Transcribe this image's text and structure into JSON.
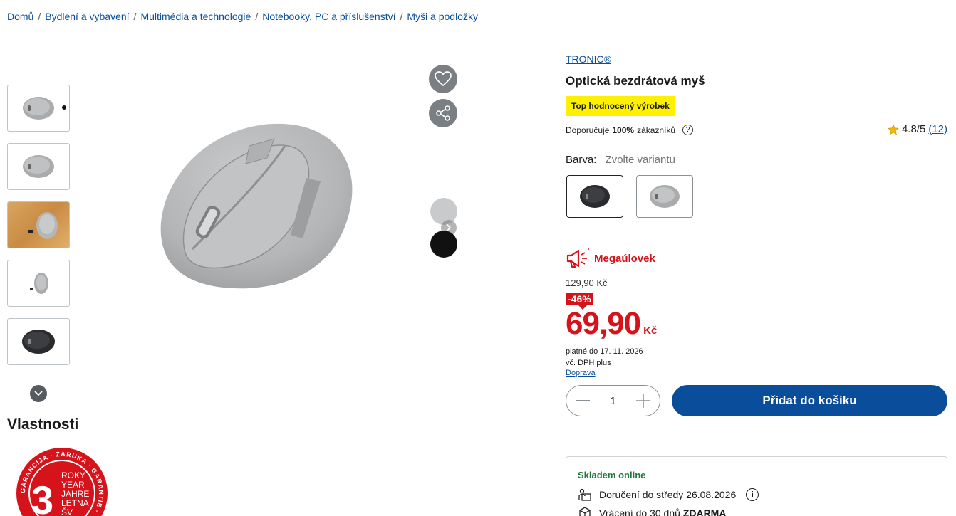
{
  "breadcrumb": [
    "Domů",
    "Bydlení a vybavení",
    "Multimédia a technologie",
    "Notebooky, PC a příslušenství",
    "Myši a podložky"
  ],
  "breadcrumb_separator": "/",
  "product": {
    "brand": "TRONIC®",
    "title": "Optická bezdrátová myš",
    "badge": "Top hodnocený výrobek",
    "recommend_prefix": "Doporučuje",
    "recommend_pct": "100%",
    "recommend_suffix": "zákazníků",
    "rating": "4.8/5",
    "rating_count": "(12)",
    "color_label": "Barva:",
    "color_placeholder": "Zvolte variantu"
  },
  "promo": {
    "label": "Megaúlovek",
    "old_price": "129,90 Kč",
    "discount": "-46%",
    "price": "69,90",
    "currency": "Kč",
    "valid": "platné do 17. 11. 2026",
    "vat": "vč. DPH plus",
    "shipping_link": "Doprava"
  },
  "cart": {
    "quantity": "1",
    "add_label": "Přidat do košíku"
  },
  "stock": {
    "title": "Skladem online",
    "delivery": "Doručení do středy 26.08.2026",
    "return_prefix": "Vrácení do 30 dnů",
    "return_bold": "ZDARMA"
  },
  "section": {
    "properties_title": "Vlastnosti"
  },
  "warranty": {
    "number": "3",
    "years": [
      "ROKY",
      "YEAR",
      "JAHRE",
      "LETNA",
      "ŠV"
    ],
    "ring": "GARANCIJA · ZÁRUKA · GARANTIE ·"
  },
  "colors": {
    "link": "#0a4e9b",
    "accent_red": "#d6121a",
    "badge_yellow": "#fff000",
    "stock_green": "#1f7a3a"
  },
  "icons": [
    "heart-icon",
    "share-icon",
    "chevron-down-icon",
    "chevron-right-icon",
    "megaphone-icon",
    "star-icon",
    "help-icon",
    "info-icon",
    "delivery-icon",
    "return-box-icon",
    "minus-icon",
    "plus-icon"
  ]
}
